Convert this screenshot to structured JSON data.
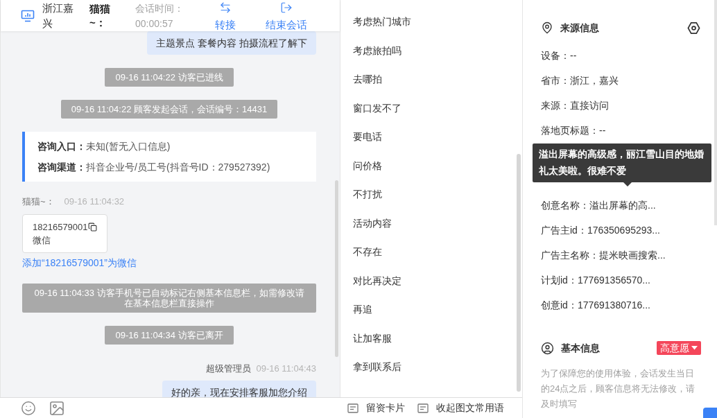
{
  "header": {
    "location": "浙江嘉兴",
    "visitor": "猫猫~：",
    "session_time_label": "会话时间：",
    "session_time": "00:00:57",
    "actions": [
      {
        "kind": "transfer",
        "label": "转接"
      },
      {
        "kind": "end",
        "label": "结束会话"
      }
    ]
  },
  "messages": [
    {
      "kind": "agent",
      "text": "主题景点 套餐内容 拍摄流程了解下"
    },
    {
      "kind": "system",
      "text": "09-16 11:04:22 访客已进线"
    },
    {
      "kind": "system",
      "text": "09-16 11:04:22 顾客发起会话，会话编号：14431"
    },
    {
      "kind": "entry_info",
      "rows": [
        {
          "label": "咨询入口：",
          "value": "未知(暂无入口信息)"
        },
        {
          "label": "咨询渠道：",
          "value": "抖音企业号/员工号(抖音号ID：279527392)"
        }
      ]
    },
    {
      "kind": "visitor_card",
      "sender": "猫猫~：",
      "time": "09-16 11:04:32",
      "phone": "18216579001",
      "card_label": "微信",
      "link": "添加“18216579001”为微信"
    },
    {
      "kind": "system",
      "text": "09-16 11:04:33 访客手机号已自动标记右侧基本信息栏，如需修改请在基本信息栏直接操作"
    },
    {
      "kind": "system",
      "text": "09-16 11:04:34 访客已离开"
    },
    {
      "kind": "agent",
      "sender": "超级管理员",
      "time": "09-16 11:04:43",
      "text": "好的亲，现在安排客服加您介绍"
    }
  ],
  "quick_replies": [
    "考虑热门城市",
    "考虑旅拍吗",
    "去哪拍",
    "窗口发不了",
    "要电话",
    "问价格",
    "不打扰",
    "活动内容",
    "不存在",
    "对比再决定",
    "再追",
    "让加客服",
    "拿到联系后"
  ],
  "footer": {
    "tools": [
      {
        "kind": "emoji"
      },
      {
        "kind": "image"
      }
    ],
    "actions": [
      "留资卡片",
      "收起图文常用语"
    ]
  },
  "source_info": {
    "title": "来源信息",
    "fields_before": [
      "设备：--",
      "省市：浙江，嘉兴",
      "来源：直接访问",
      "落地页标题：--"
    ],
    "tooltip": "溢出屏幕的高级感，丽江雪山目的地婚礼太美啦。很难不爱",
    "fields_after": [
      "创意名称：溢出屏幕的高...",
      "广告主id：176350695293...",
      "广告主名称：提米映画搜索...",
      "计划id：177691356570...",
      "创意id：177691380716..."
    ]
  },
  "basic_info": {
    "title": "基本信息",
    "intent": "高意愿",
    "note": "为了保障您的使用体验，会话发生当日的24点之后，顾客信息将无法修改，请及时填写"
  }
}
